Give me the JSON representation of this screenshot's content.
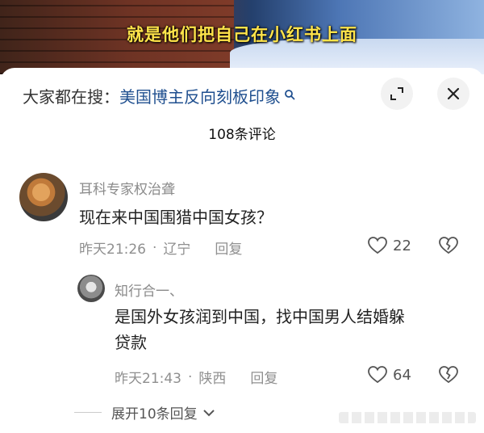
{
  "video": {
    "subtitle": "就是他们把自己在小红书上面"
  },
  "search": {
    "prefix": "大家都在搜：",
    "term": "美国博主反向刻板印象"
  },
  "header": {
    "comment_count": "108条评论"
  },
  "comment": {
    "username": "耳科专家权治聋",
    "text": "现在来中国围猎中国女孩？",
    "time": "昨天21:26",
    "location": "辽宁",
    "reply_label": "回复",
    "likes": "22"
  },
  "reply": {
    "username": "知行合一、",
    "text_line1": "是国外女孩润到中国，找中国男人结婚躲",
    "text_line2": "贷款",
    "time": "昨天21:43",
    "location": "陕西",
    "reply_label": "回复",
    "likes": "64"
  },
  "expand": {
    "label": "展开10条回复"
  },
  "colors": {
    "accent_link": "#1f4f8f",
    "subtitle_yellow": "#ffe44a"
  }
}
